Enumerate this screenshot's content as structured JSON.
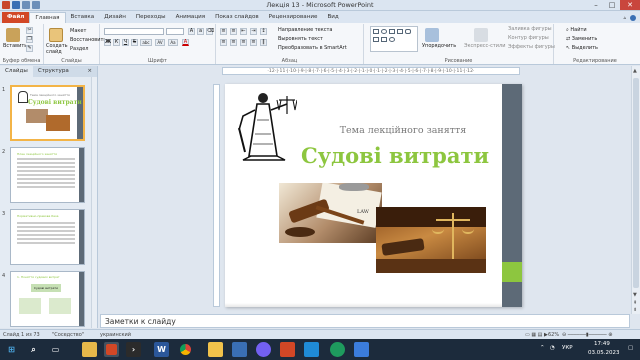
{
  "window": {
    "title": "Лекція 13  -  Microsoft PowerPoint",
    "controls": [
      "–",
      "□",
      "✕"
    ]
  },
  "tabs": [
    {
      "label": "Файл"
    },
    {
      "label": "Главная"
    },
    {
      "label": "Вставка"
    },
    {
      "label": "Дизайн"
    },
    {
      "label": "Переходы"
    },
    {
      "label": "Анимация"
    },
    {
      "label": "Показ слайдов"
    },
    {
      "label": "Рецензирование"
    },
    {
      "label": "Вид"
    }
  ],
  "ribbon": {
    "clipboard": {
      "paste": "Вставить",
      "group": "Буфер обмена"
    },
    "slides": {
      "new_slide": "Создать слайд",
      "layout": "Макет",
      "reset": "Восстановить",
      "section": "Раздел",
      "group": "Слайды"
    },
    "font": {
      "name": "",
      "size": "",
      "group": "Шрифт",
      "bold": "Ж",
      "italic": "К",
      "underline": "Ч",
      "strike": "S",
      "shadow": "abc",
      "spacing": "AV",
      "case": "Aa",
      "color": "A"
    },
    "paragraph": {
      "text_direction": "Направление текста",
      "align_text": "Выровнять текст",
      "smartart": "Преобразовать в SmartArt",
      "group": "Абзац"
    },
    "drawing": {
      "arrange": "Упорядочить",
      "quick_styles": "Экспресс-стили",
      "fill": "Заливка фигуры",
      "outline": "Контур фигуры",
      "effects": "Эффекты фигуры",
      "group": "Рисование"
    },
    "editing": {
      "find": "Найти",
      "replace": "Заменить",
      "select": "Выделить",
      "group": "Редактирование"
    }
  },
  "pane": {
    "tabs": [
      "Слайды",
      "Структура",
      "×"
    ],
    "thumbnails": [
      {
        "number": "1",
        "title": "Тема лекційного заняття",
        "subtitle": "Судові витрати"
      },
      {
        "number": "2",
        "title": "План лекційного заняття",
        "subtitle": ""
      },
      {
        "number": "3",
        "title": "Нормативно-правова база",
        "subtitle": ""
      },
      {
        "number": "4",
        "title": "1. Поняття судових витрат",
        "subtitle": "Судові витрати"
      }
    ]
  },
  "ruler": {
    "ticks": "·12·|·11·|·10·|·9·|·8·|·7·|·6·|·5·|·4·|·3·|·2·|·1·|·0·|·1·|·2·|·3·|·4·|·5·|·6·|·7·|·8·|·9·|·10·|·11·|·12·"
  },
  "slide": {
    "topic": "Тема лекційного заняття",
    "headline": "Судові витрати",
    "accent_color": "#8dc63f",
    "bar_color": "#5d6a77"
  },
  "notes": {
    "placeholder": "Заметки к слайду"
  },
  "status": {
    "slide_info": "Слайд 1 из 73",
    "theme": "\"Соседство\"",
    "language": "украинский",
    "zoom": "62%"
  },
  "taskbar": {
    "apps": [
      "start-icon",
      "search-icon",
      "file-explorer-icon",
      "powerpoint-icon",
      "terminal-icon",
      "word-icon",
      "chrome-icon",
      "folder-icon",
      "calendar-icon",
      "viber-icon",
      "mail-icon",
      "edge-icon",
      "store-icon"
    ],
    "lang": "УКР",
    "time": "17:49",
    "date": "03.05.2023"
  }
}
